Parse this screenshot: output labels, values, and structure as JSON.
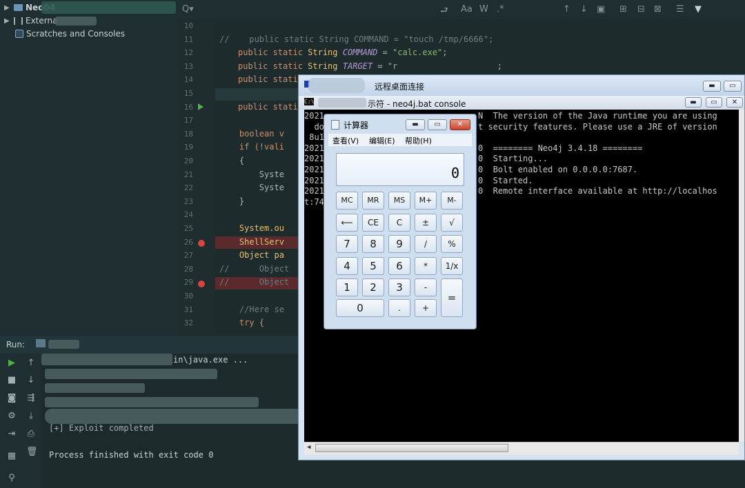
{
  "project_tree": {
    "root": "Neo04",
    "external": "Externa",
    "scratches": "Scratches and Consoles"
  },
  "editor": {
    "lines": [
      {
        "n": "10",
        "text": ""
      },
      {
        "n": "11",
        "text": "//    public static String COMMAND = \"touch /tmp/6666\";"
      },
      {
        "n": "12",
        "a": "public static ",
        "b": "String ",
        "c": "COMMAND",
        "d": " = ",
        "e": "\"calc.exe\"",
        "f": ";"
      },
      {
        "n": "13",
        "a": "public static ",
        "b": "String ",
        "c": "TARGET",
        "d": " = ",
        "e": "\"r",
        "f": "                    ;"
      },
      {
        "n": "14",
        "a": "public stati",
        "b": "",
        "c": "",
        "d": "",
        "e": "",
        "f": ""
      },
      {
        "n": "15",
        "text": ""
      },
      {
        "n": "16",
        "a": "public stati",
        "b": "",
        "c": "",
        "d": "",
        "e": "",
        "f": ""
      },
      {
        "n": "17",
        "text": ""
      },
      {
        "n": "18",
        "text": "    boolean v"
      },
      {
        "n": "19",
        "text": "    if (!vali"
      },
      {
        "n": "20",
        "text": "    {"
      },
      {
        "n": "21",
        "text": "        Syste"
      },
      {
        "n": "22",
        "text": "        Syste"
      },
      {
        "n": "23",
        "text": "    }"
      },
      {
        "n": "24",
        "text": ""
      },
      {
        "n": "25",
        "text": "    System.ou"
      },
      {
        "n": "26",
        "text": "    ShellServ"
      },
      {
        "n": "27",
        "text": "    Object pa"
      },
      {
        "n": "28",
        "text": "//      Object"
      },
      {
        "n": "29",
        "text": "//      Object"
      },
      {
        "n": "30",
        "text": ""
      },
      {
        "n": "31",
        "text": "    //Here se"
      },
      {
        "n": "32",
        "text": "    try {"
      }
    ]
  },
  "run": {
    "label": "Run:",
    "cmd_tail": "in\\java.exe ...",
    "exploit_line": "[+] Exploit completed",
    "finish_line": "Process finished with exit code 0"
  },
  "rdp": {
    "title": "远程桌面连接",
    "console_title": "示符 - neo4j.bat  console",
    "console_prefix": "C:\\",
    "console_lines": [
      {
        "left": "2021",
        "right": "N  The version of the Java runtime you are using"
      },
      {
        "left": "  do",
        "right": "t security features. Please use a JRE of version"
      },
      {
        "left": " 8u1",
        "right": ""
      },
      {
        "left": "2021",
        "right": "0  ======== Neo4j 3.4.18 ========"
      },
      {
        "left": "2021",
        "right": "0  Starting..."
      },
      {
        "left": "2021",
        "right": "0  Bolt enabled on 0.0.0.0:7687."
      },
      {
        "left": "2021",
        "right": "0  Started."
      },
      {
        "left": "2021",
        "right": "0  Remote interface available at http://localhos"
      },
      {
        "left": "t:74",
        "right": ""
      }
    ]
  },
  "calculator": {
    "title": "计算器",
    "menu": [
      "查看(V)",
      "编辑(E)",
      "帮助(H)"
    ],
    "display": "0",
    "keys": {
      "mc": "MC",
      "mr": "MR",
      "ms": "MS",
      "mplus": "M+",
      "mminus": "M-",
      "back": "⟵",
      "ce": "CE",
      "c": "C",
      "pm": "±",
      "sqrt": "√",
      "k7": "7",
      "k8": "8",
      "k9": "9",
      "div": "/",
      "pct": "%",
      "k4": "4",
      "k5": "5",
      "k6": "6",
      "mul": "*",
      "inv": "1/x",
      "k1": "1",
      "k2": "2",
      "k3": "3",
      "sub": "-",
      "eq": "=",
      "k0": "0",
      "dot": ".",
      "add": "+"
    }
  }
}
